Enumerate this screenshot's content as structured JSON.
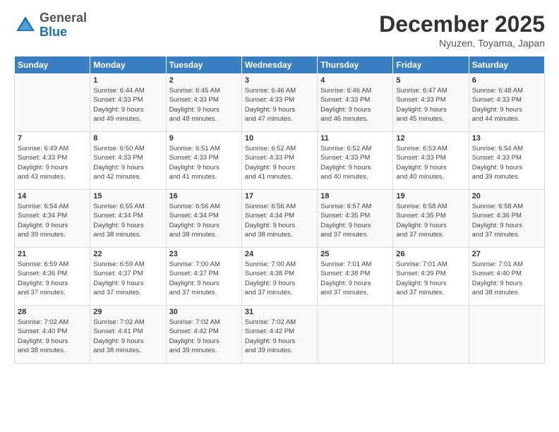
{
  "header": {
    "logo": {
      "general": "General",
      "blue": "Blue"
    },
    "title": "December 2025",
    "location": "Nyuzen, Toyama, Japan"
  },
  "calendar": {
    "days_of_week": [
      "Sunday",
      "Monday",
      "Tuesday",
      "Wednesday",
      "Thursday",
      "Friday",
      "Saturday"
    ],
    "weeks": [
      [
        {
          "day": "",
          "info": ""
        },
        {
          "day": "1",
          "info": "Sunrise: 6:44 AM\nSunset: 4:33 PM\nDaylight: 9 hours\nand 49 minutes."
        },
        {
          "day": "2",
          "info": "Sunrise: 6:45 AM\nSunset: 4:33 PM\nDaylight: 9 hours\nand 48 minutes."
        },
        {
          "day": "3",
          "info": "Sunrise: 6:46 AM\nSunset: 4:33 PM\nDaylight: 9 hours\nand 47 minutes."
        },
        {
          "day": "4",
          "info": "Sunrise: 6:46 AM\nSunset: 4:33 PM\nDaylight: 9 hours\nand 46 minutes."
        },
        {
          "day": "5",
          "info": "Sunrise: 6:47 AM\nSunset: 4:33 PM\nDaylight: 9 hours\nand 45 minutes."
        },
        {
          "day": "6",
          "info": "Sunrise: 6:48 AM\nSunset: 4:33 PM\nDaylight: 9 hours\nand 44 minutes."
        }
      ],
      [
        {
          "day": "7",
          "info": "Sunrise: 6:49 AM\nSunset: 4:33 PM\nDaylight: 9 hours\nand 43 minutes."
        },
        {
          "day": "8",
          "info": "Sunrise: 6:50 AM\nSunset: 4:33 PM\nDaylight: 9 hours\nand 42 minutes."
        },
        {
          "day": "9",
          "info": "Sunrise: 6:51 AM\nSunset: 4:33 PM\nDaylight: 9 hours\nand 41 minutes."
        },
        {
          "day": "10",
          "info": "Sunrise: 6:52 AM\nSunset: 4:33 PM\nDaylight: 9 hours\nand 41 minutes."
        },
        {
          "day": "11",
          "info": "Sunrise: 6:52 AM\nSunset: 4:33 PM\nDaylight: 9 hours\nand 40 minutes."
        },
        {
          "day": "12",
          "info": "Sunrise: 6:53 AM\nSunset: 4:33 PM\nDaylight: 9 hours\nand 40 minutes."
        },
        {
          "day": "13",
          "info": "Sunrise: 6:54 AM\nSunset: 4:33 PM\nDaylight: 9 hours\nand 39 minutes."
        }
      ],
      [
        {
          "day": "14",
          "info": "Sunrise: 6:54 AM\nSunset: 4:34 PM\nDaylight: 9 hours\nand 39 minutes."
        },
        {
          "day": "15",
          "info": "Sunrise: 6:55 AM\nSunset: 4:34 PM\nDaylight: 9 hours\nand 38 minutes."
        },
        {
          "day": "16",
          "info": "Sunrise: 6:56 AM\nSunset: 4:34 PM\nDaylight: 9 hours\nand 38 minutes."
        },
        {
          "day": "17",
          "info": "Sunrise: 6:56 AM\nSunset: 4:34 PM\nDaylight: 9 hours\nand 38 minutes."
        },
        {
          "day": "18",
          "info": "Sunrise: 6:57 AM\nSunset: 4:35 PM\nDaylight: 9 hours\nand 37 minutes."
        },
        {
          "day": "19",
          "info": "Sunrise: 6:58 AM\nSunset: 4:35 PM\nDaylight: 9 hours\nand 37 minutes."
        },
        {
          "day": "20",
          "info": "Sunrise: 6:58 AM\nSunset: 4:36 PM\nDaylight: 9 hours\nand 37 minutes."
        }
      ],
      [
        {
          "day": "21",
          "info": "Sunrise: 6:59 AM\nSunset: 4:36 PM\nDaylight: 9 hours\nand 37 minutes."
        },
        {
          "day": "22",
          "info": "Sunrise: 6:59 AM\nSunset: 4:37 PM\nDaylight: 9 hours\nand 37 minutes."
        },
        {
          "day": "23",
          "info": "Sunrise: 7:00 AM\nSunset: 4:37 PM\nDaylight: 9 hours\nand 37 minutes."
        },
        {
          "day": "24",
          "info": "Sunrise: 7:00 AM\nSunset: 4:38 PM\nDaylight: 9 hours\nand 37 minutes."
        },
        {
          "day": "25",
          "info": "Sunrise: 7:01 AM\nSunset: 4:38 PM\nDaylight: 9 hours\nand 37 minutes."
        },
        {
          "day": "26",
          "info": "Sunrise: 7:01 AM\nSunset: 4:39 PM\nDaylight: 9 hours\nand 37 minutes."
        },
        {
          "day": "27",
          "info": "Sunrise: 7:01 AM\nSunset: 4:40 PM\nDaylight: 9 hours\nand 38 minutes."
        }
      ],
      [
        {
          "day": "28",
          "info": "Sunrise: 7:02 AM\nSunset: 4:40 PM\nDaylight: 9 hours\nand 38 minutes."
        },
        {
          "day": "29",
          "info": "Sunrise: 7:02 AM\nSunset: 4:41 PM\nDaylight: 9 hours\nand 38 minutes."
        },
        {
          "day": "30",
          "info": "Sunrise: 7:02 AM\nSunset: 4:42 PM\nDaylight: 9 hours\nand 39 minutes."
        },
        {
          "day": "31",
          "info": "Sunrise: 7:02 AM\nSunset: 4:42 PM\nDaylight: 9 hours\nand 39 minutes."
        },
        {
          "day": "",
          "info": ""
        },
        {
          "day": "",
          "info": ""
        },
        {
          "day": "",
          "info": ""
        }
      ]
    ]
  }
}
